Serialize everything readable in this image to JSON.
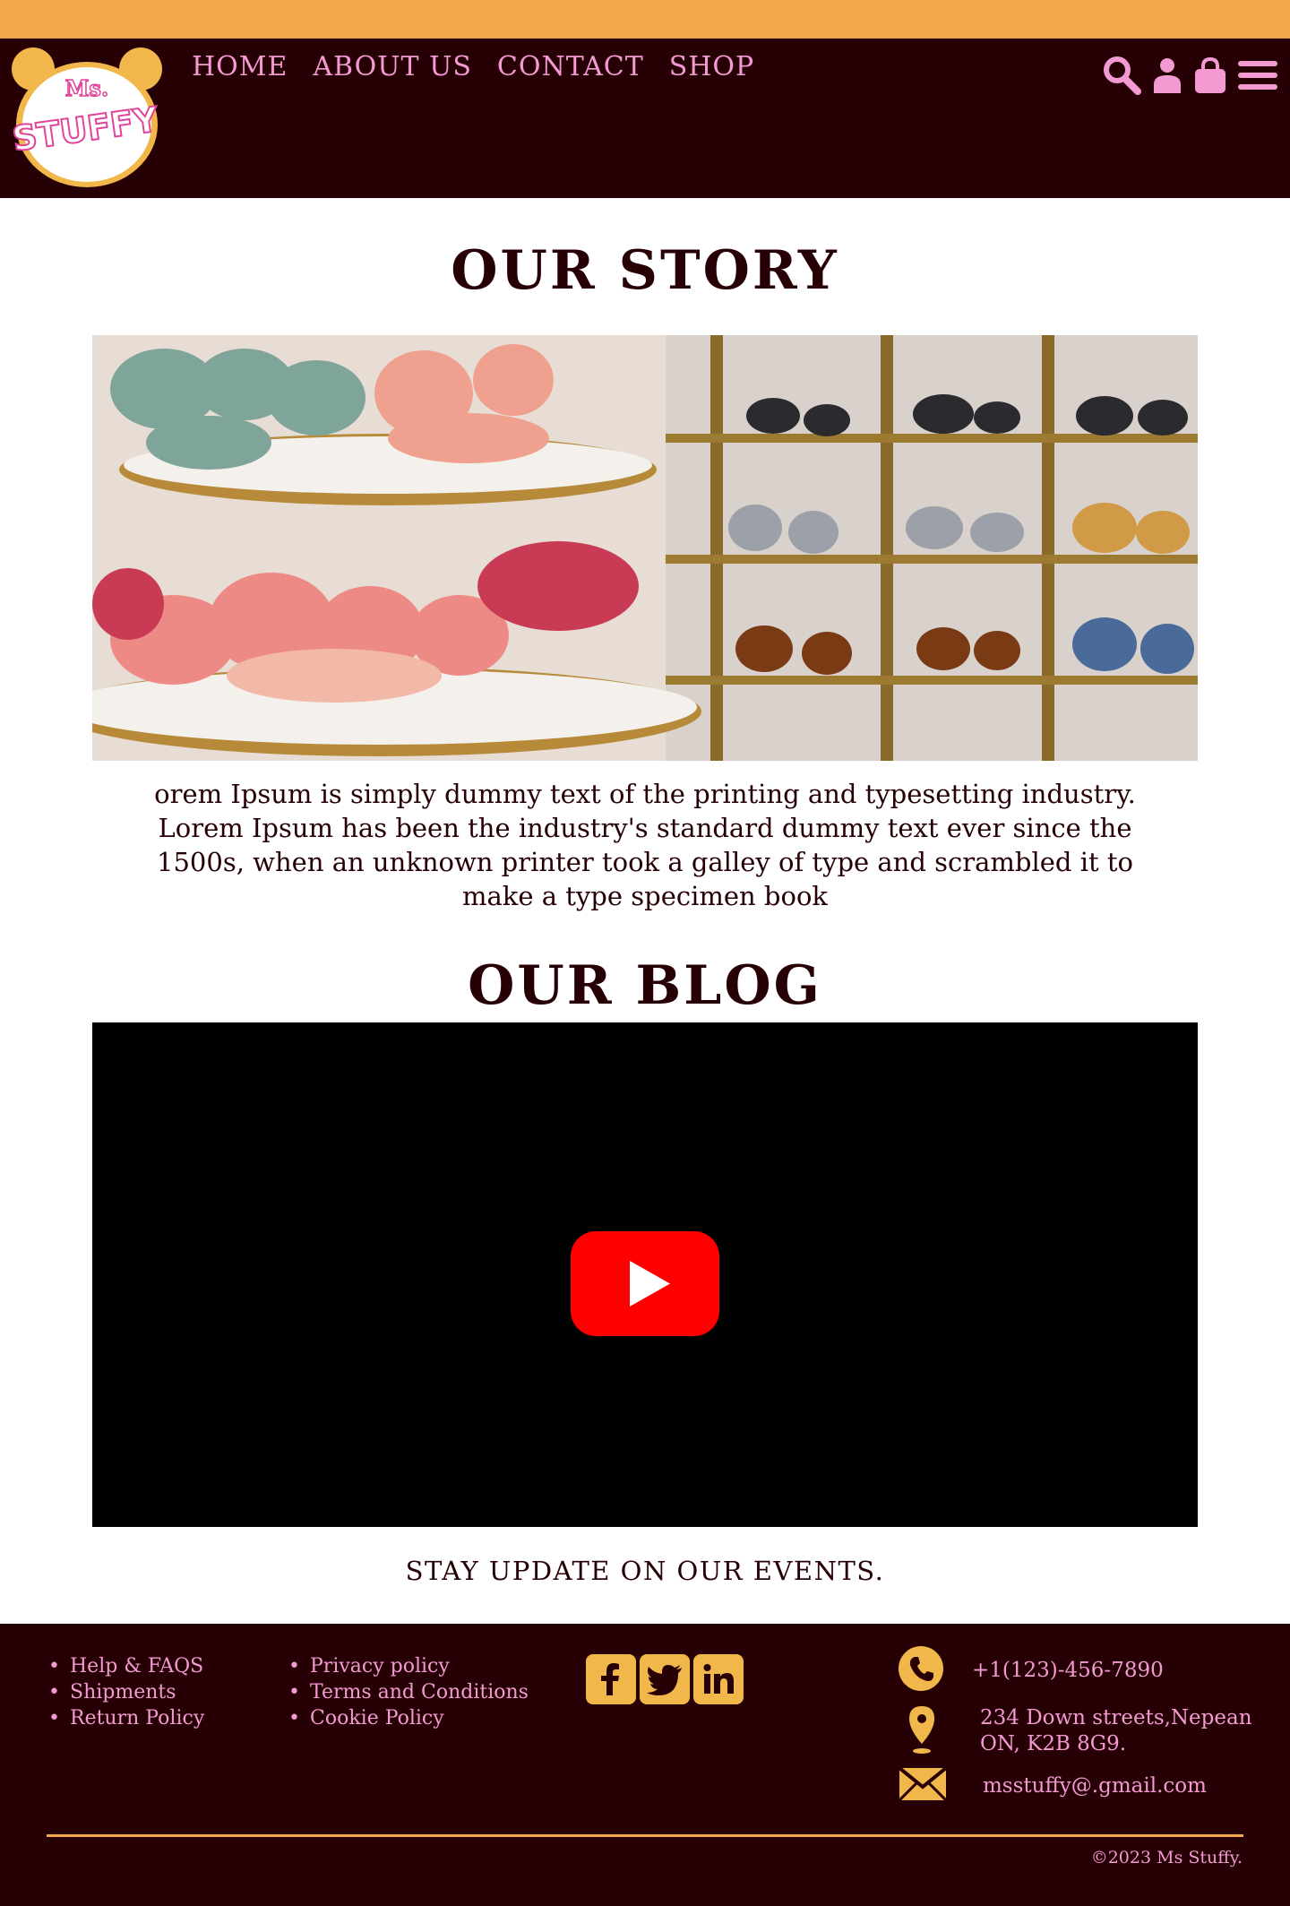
{
  "colors": {
    "accent_orange": "#f2a74b",
    "dark_maroon": "#260004",
    "nav_pink": "#f39ad3",
    "icon_yellow": "#f2b74b",
    "youtube_red": "#ff0000"
  },
  "brand": {
    "logo_text": "Ms. Stuffy",
    "logo_icon": "teddy-bear-logo"
  },
  "nav": {
    "items": [
      {
        "label": "HOME"
      },
      {
        "label": "ABOUT US"
      },
      {
        "label": "CONTACT"
      },
      {
        "label": "SHOP"
      }
    ],
    "icons": [
      "search-icon",
      "user-icon",
      "shopping-bag-icon",
      "menu-icon"
    ]
  },
  "story": {
    "title": "OUR STORY",
    "text": "orem Ipsum is simply dummy text of the printing and typesetting industry. Lorem Ipsum has been the industry's standard dummy text ever since the 1500s, when an unknown printer took a galley of type and scrambled it to make a type specimen book"
  },
  "blog": {
    "title": "OUR BLOG",
    "video_icon": "youtube-play-icon"
  },
  "events": {
    "label": "STAY UPDATE ON OUR EVENTS."
  },
  "footer": {
    "links_1": [
      "Help & FAQS",
      "Shipments",
      "Return Policy"
    ],
    "links_2": [
      "Privacy policy",
      "Terms and Conditions",
      "Cookie Policy"
    ],
    "social": [
      "facebook-icon",
      "twitter-icon",
      "linkedin-icon"
    ],
    "phone": "+1(123)-456-7890",
    "address_line1": "234 Down streets,Nepean",
    "address_line2": "ON, K2B 8G9.",
    "email": "msstuffy@.gmail.com",
    "copyright": "©2023 Ms Stuffy."
  }
}
